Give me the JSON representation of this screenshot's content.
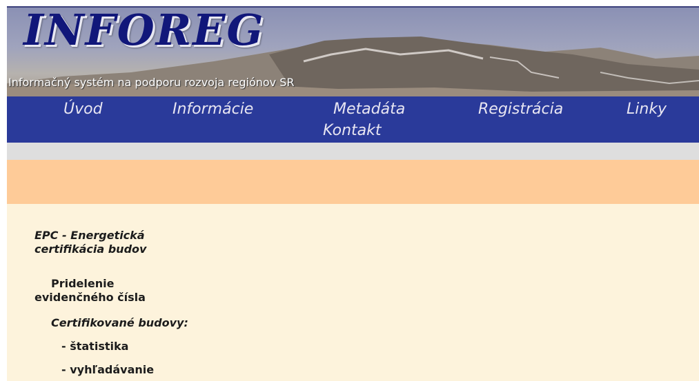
{
  "banner": {
    "title": "INFOREG",
    "subtitle": "Informačný systém na podporu rozvoja regiónov SR"
  },
  "nav": {
    "items": [
      "Úvod",
      "Informácie",
      "Metadáta",
      "Registrácia",
      "Linky",
      "Kontakt"
    ]
  },
  "content": {
    "epc_line1": "EPC - Energetická",
    "epc_line2": "certifikácia budov",
    "assign_line1": "Pridelenie",
    "assign_line2": "evidenčného čísla",
    "certified_heading": "Certifikované budovy:",
    "stats": "- štatistika",
    "search": "- vyhľadávanie"
  },
  "colors": {
    "nav_bg": "#2a3a9a",
    "gray_band": "#dedede",
    "peach_band": "#fecb98",
    "content_bg": "#fdf3dc",
    "title_color": "#11177a"
  }
}
